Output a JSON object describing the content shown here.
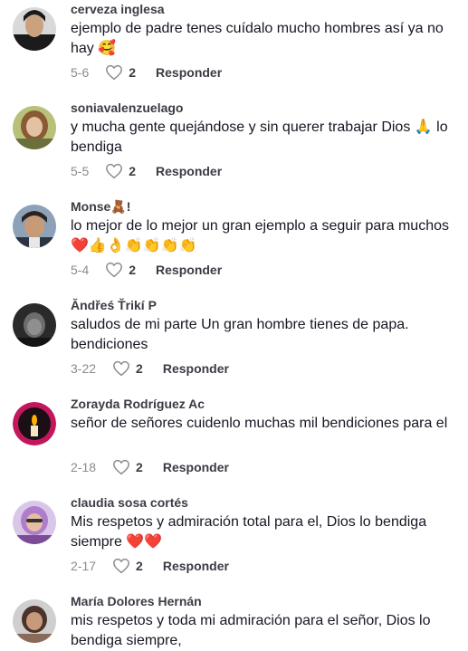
{
  "comments": [
    {
      "username": "cerveza inglesa",
      "text": "ejemplo de padre tenes cuídalo mucho hombres así ya no hay 🥰",
      "date": "5-6",
      "likes": "2",
      "reply_label": "Responder"
    },
    {
      "username": "soniavalenzuelago",
      "text": "y mucha gente quejándose y sin querer trabajar Dios 🙏 lo bendiga",
      "date": "5-5",
      "likes": "2",
      "reply_label": "Responder"
    },
    {
      "username": "Monse🧸!",
      "text": "lo mejor de lo mejor un gran ejemplo a seguir para muchos ❤️👍👌👏👏👏👏",
      "date": "5-4",
      "likes": "2",
      "reply_label": "Responder"
    },
    {
      "username": "Ăndřeś Ťrikí P",
      "text": "saludos de mi parte Un gran hombre tienes de papa. bendiciones",
      "date": "3-22",
      "likes": "2",
      "reply_label": "Responder"
    },
    {
      "username": "Zorayda Rodríguez Ac",
      "text": "señor de señores cuidenlo muchas mil bendiciones para el",
      "date": "2-18",
      "likes": "2",
      "reply_label": "Responder"
    },
    {
      "username": "claudia sosa cortés",
      "text": "Mis respetos y admiración total para el, Dios lo bendiga siempre ❤️❤️",
      "date": "2-17",
      "likes": "2",
      "reply_label": "Responder"
    },
    {
      "username": "María Dolores Hernán",
      "text": "mis respetos y toda mi admiración para el señor, Dios lo bendiga siempre,",
      "date": "",
      "likes": "",
      "reply_label": ""
    }
  ]
}
